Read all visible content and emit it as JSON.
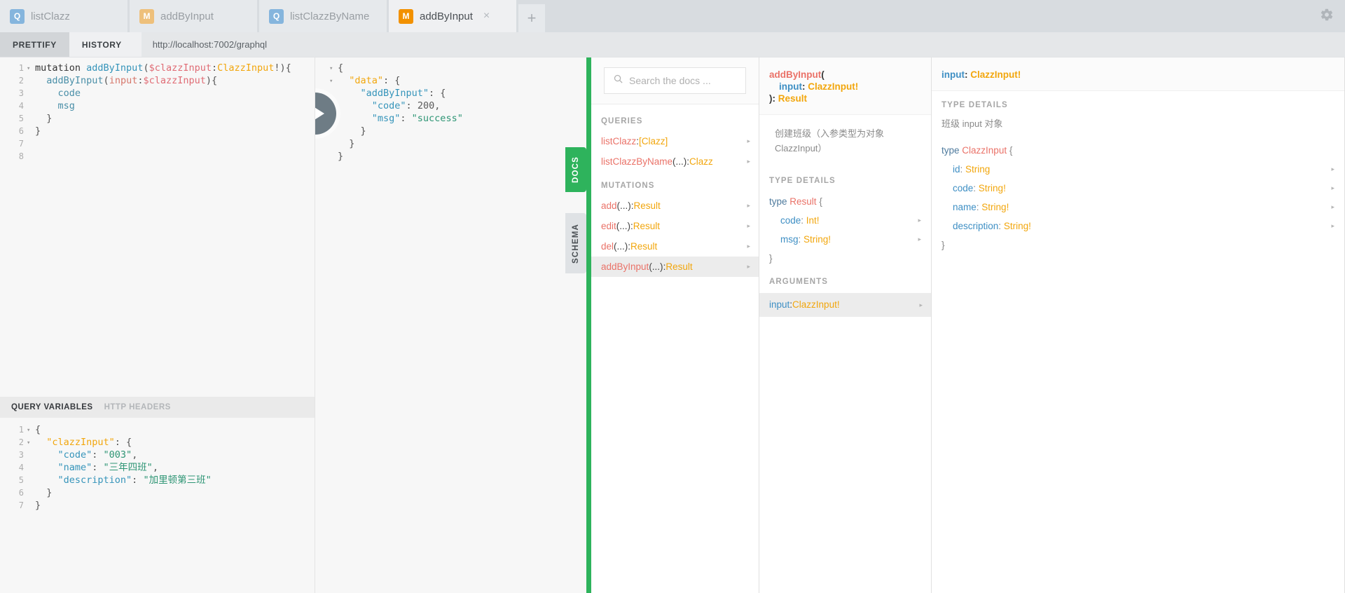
{
  "tabs": [
    {
      "badge": "Q",
      "kind": "query",
      "label": "listClazz",
      "active": false
    },
    {
      "badge": "M",
      "kind": "mutation",
      "label": "addByInput",
      "active": false
    },
    {
      "badge": "Q",
      "kind": "query",
      "label": "listClazzByName",
      "active": false
    },
    {
      "badge": "M",
      "kind": "mutation",
      "label": "addByInput",
      "active": true,
      "close": "×"
    }
  ],
  "tab_add_label": "+",
  "gear_icon": "gear-icon",
  "toolbar": {
    "prettify_label": "PRETTIFY",
    "history_label": "HISTORY",
    "url": "http://localhost:7002/graphql"
  },
  "query_editor": {
    "lines": [
      {
        "n": "1",
        "fold": "▾",
        "segments": [
          {
            "t": "mutation ",
            "c": "k-kw"
          },
          {
            "t": "addByInput",
            "c": "k-name"
          },
          {
            "t": "(",
            "c": "k-punct"
          },
          {
            "t": "$clazzInput",
            "c": "k-var"
          },
          {
            "t": ":",
            "c": "k-punct"
          },
          {
            "t": "ClazzInput",
            "c": "k-type"
          },
          {
            "t": "!){",
            "c": "k-punct"
          }
        ]
      },
      {
        "n": "2",
        "fold": "",
        "segments": [
          {
            "t": "  addByInput",
            "c": "k-field"
          },
          {
            "t": "(",
            "c": "k-punct"
          },
          {
            "t": "input",
            "c": "k-attr"
          },
          {
            "t": ":",
            "c": "k-punct"
          },
          {
            "t": "$clazzInput",
            "c": "k-var"
          },
          {
            "t": "){",
            "c": "k-punct"
          }
        ]
      },
      {
        "n": "3",
        "fold": "",
        "segments": [
          {
            "t": "    code",
            "c": "k-field"
          }
        ]
      },
      {
        "n": "4",
        "fold": "",
        "segments": [
          {
            "t": "    msg",
            "c": "k-field"
          }
        ]
      },
      {
        "n": "5",
        "fold": "",
        "segments": [
          {
            "t": "  }",
            "c": "k-punct"
          }
        ]
      },
      {
        "n": "6",
        "fold": "",
        "segments": [
          {
            "t": "}",
            "c": "k-punct"
          }
        ]
      },
      {
        "n": "7",
        "fold": "",
        "segments": [
          {
            "t": "",
            "c": "k-punct"
          }
        ]
      },
      {
        "n": "8",
        "fold": "",
        "segments": [
          {
            "t": "",
            "c": "k-punct"
          }
        ]
      }
    ]
  },
  "variables_pane": {
    "tab_query_variables": "QUERY VARIABLES",
    "tab_http_headers": "HTTP HEADERS",
    "lines": [
      {
        "n": "1",
        "fold": "▾",
        "segments": [
          {
            "t": "{",
            "c": "k-punct"
          }
        ]
      },
      {
        "n": "2",
        "fold": "▾",
        "segments": [
          {
            "t": "  \"clazzInput\"",
            "c": "k-key-o"
          },
          {
            "t": ": {",
            "c": "k-punct"
          }
        ]
      },
      {
        "n": "3",
        "fold": "",
        "segments": [
          {
            "t": "    \"code\"",
            "c": "k-key"
          },
          {
            "t": ": ",
            "c": "k-punct"
          },
          {
            "t": "\"003\"",
            "c": "k-str"
          },
          {
            "t": ",",
            "c": "k-punct"
          }
        ]
      },
      {
        "n": "4",
        "fold": "",
        "segments": [
          {
            "t": "    \"name\"",
            "c": "k-key"
          },
          {
            "t": ": ",
            "c": "k-punct"
          },
          {
            "t": "\"三年四班\"",
            "c": "k-str"
          },
          {
            "t": ",",
            "c": "k-punct"
          }
        ]
      },
      {
        "n": "5",
        "fold": "",
        "segments": [
          {
            "t": "    \"description\"",
            "c": "k-key"
          },
          {
            "t": ": ",
            "c": "k-punct"
          },
          {
            "t": "\"加里顿第三班\"",
            "c": "k-str"
          }
        ]
      },
      {
        "n": "6",
        "fold": "",
        "segments": [
          {
            "t": "  }",
            "c": "k-punct"
          }
        ]
      },
      {
        "n": "7",
        "fold": "",
        "segments": [
          {
            "t": "}",
            "c": "k-punct"
          }
        ]
      }
    ]
  },
  "result_pane": {
    "execute_icon": "play-icon",
    "lines": [
      {
        "fold": "▾",
        "segments": [
          {
            "t": "{",
            "c": "k-punct"
          }
        ]
      },
      {
        "fold": "▾",
        "segments": [
          {
            "t": "  \"data\"",
            "c": "k-key-o"
          },
          {
            "t": ": {",
            "c": "k-punct"
          }
        ]
      },
      {
        "fold": "",
        "segments": [
          {
            "t": "    \"addByInput\"",
            "c": "k-key"
          },
          {
            "t": ": {",
            "c": "k-punct"
          }
        ]
      },
      {
        "fold": "",
        "segments": [
          {
            "t": "      \"code\"",
            "c": "k-key"
          },
          {
            "t": ": ",
            "c": "k-punct"
          },
          {
            "t": "200",
            "c": "k-num"
          },
          {
            "t": ",",
            "c": "k-punct"
          }
        ]
      },
      {
        "fold": "",
        "segments": [
          {
            "t": "      \"msg\"",
            "c": "k-key"
          },
          {
            "t": ": ",
            "c": "k-punct"
          },
          {
            "t": "\"success\"",
            "c": "k-str"
          }
        ]
      },
      {
        "fold": "",
        "segments": [
          {
            "t": "    }",
            "c": "k-punct"
          }
        ]
      },
      {
        "fold": "",
        "segments": [
          {
            "t": "  }",
            "c": "k-punct"
          }
        ]
      },
      {
        "fold": "",
        "segments": [
          {
            "t": "}",
            "c": "k-punct"
          }
        ]
      }
    ]
  },
  "side_tabs": {
    "docs": "DOCS",
    "schema": "SCHEMA"
  },
  "docs": {
    "search_placeholder": "Search the docs ...",
    "search_value": "",
    "search_icon": "search-icon",
    "sections": [
      {
        "title": "QUERIES",
        "items": [
          {
            "name": "listClazz",
            "sep": ": ",
            "type": "[Clazz]",
            "args": "",
            "selected": false,
            "arrow": "▸"
          },
          {
            "name": "listClazzByName",
            "sep": ": ",
            "type": "Clazz",
            "args": "(...)",
            "selected": false,
            "arrow": "▸"
          }
        ]
      },
      {
        "title": "MUTATIONS",
        "items": [
          {
            "name": "add",
            "sep": ": ",
            "type": "Result",
            "args": "(...)",
            "selected": false,
            "arrow": "▸"
          },
          {
            "name": "edit",
            "sep": ": ",
            "type": "Result",
            "args": "(...)",
            "selected": false,
            "arrow": "▸"
          },
          {
            "name": "del",
            "sep": ": ",
            "type": "Result",
            "args": "(...)",
            "selected": false,
            "arrow": "▸"
          },
          {
            "name": "addByInput",
            "sep": ": ",
            "type": "Result",
            "args": "(...)",
            "selected": true,
            "arrow": "▸"
          }
        ]
      }
    ],
    "detail_field": {
      "head": {
        "name": "addByInput",
        "open_paren": "(",
        "arg_name": "input",
        "arg_sep": ": ",
        "arg_type": "ClazzInput!",
        "close_paren": ")",
        "ret_sep": ": ",
        "ret_type": "Result"
      },
      "description": "创建班级（入参类型为对象ClazzInput）",
      "type_details_title": "TYPE DETAILS",
      "type_decl_kw": "type",
      "type_decl_name": "Result",
      "type_open": "{",
      "type_close": "}",
      "fields": [
        {
          "name": "code",
          "sep": ": ",
          "type": "Int!",
          "arrow": "▸"
        },
        {
          "name": "msg",
          "sep": ": ",
          "type": "String!",
          "arrow": "▸"
        }
      ]
    },
    "detail_arg": {
      "head": {
        "name": "input",
        "sep": ": ",
        "type": "ClazzInput!"
      },
      "type_details_title": "TYPE DETAILS",
      "description": "班级 input 对象",
      "type_decl_kw": "type",
      "type_decl_name": "ClazzInput",
      "type_open": "{",
      "type_close": "}",
      "fields": [
        {
          "name": "id",
          "sep": ": ",
          "type": "String",
          "arrow": "▸"
        },
        {
          "name": "code",
          "sep": ": ",
          "type": "String!",
          "arrow": "▸"
        },
        {
          "name": "name",
          "sep": ": ",
          "type": "String!",
          "arrow": "▸"
        },
        {
          "name": "description",
          "sep": ": ",
          "type": "String!",
          "arrow": "▸"
        }
      ]
    },
    "arguments_title": "ARGUMENTS",
    "argument_item": {
      "name": "input",
      "sep": ": ",
      "type": "ClazzInput!",
      "selected": true,
      "arrow": "▸"
    }
  },
  "colors": {
    "accent_green": "#2eb35c",
    "mutation_orange": "#f29100",
    "query_blue": "#85b5dd"
  }
}
